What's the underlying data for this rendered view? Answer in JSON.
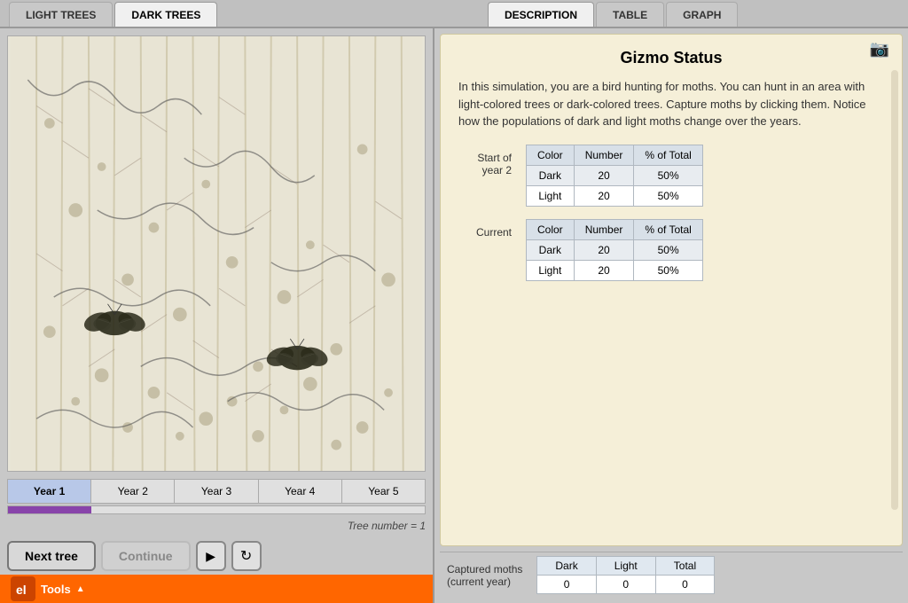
{
  "tabs": {
    "left": [
      {
        "label": "LIGHT TREES",
        "active": false
      },
      {
        "label": "DARK TREES",
        "active": true
      }
    ],
    "right": [
      {
        "label": "DESCRIPTION",
        "active": true
      },
      {
        "label": "TABLE",
        "active": false
      },
      {
        "label": "GRAPH",
        "active": false
      }
    ]
  },
  "year_tabs": [
    {
      "label": "Year 1",
      "active": true
    },
    {
      "label": "Year 2",
      "active": false
    },
    {
      "label": "Year 3",
      "active": false
    },
    {
      "label": "Year 4",
      "active": false
    },
    {
      "label": "Year 5",
      "active": false
    }
  ],
  "tree_number_label": "Tree number = 1",
  "buttons": {
    "next_tree": "Next tree",
    "continue": "Continue"
  },
  "tools_label": "Tools",
  "gizmo": {
    "title": "Gizmo Status",
    "description": "In this simulation, you are a bird hunting for moths. You can hunt in an area with light-colored trees or dark-colored trees. Capture moths by clicking them. Notice how the populations of dark and light moths change over the years.",
    "start_of_year": "Start of\nyear 2",
    "current_label": "Current",
    "table_headers": [
      "Color",
      "Number",
      "% of Total"
    ],
    "start_rows": [
      {
        "color": "Dark",
        "number": "20",
        "percent": "50%"
      },
      {
        "color": "Light",
        "number": "20",
        "percent": "50%"
      }
    ],
    "current_rows": [
      {
        "color": "Dark",
        "number": "20",
        "percent": "50%"
      },
      {
        "color": "Light",
        "number": "20",
        "percent": "50%"
      }
    ]
  },
  "captured": {
    "label": "Captured moths\n(current year)",
    "headers": [
      "Dark",
      "Light",
      "Total"
    ],
    "values": [
      "0",
      "0",
      "0"
    ]
  },
  "progress": {
    "percent": 20
  }
}
